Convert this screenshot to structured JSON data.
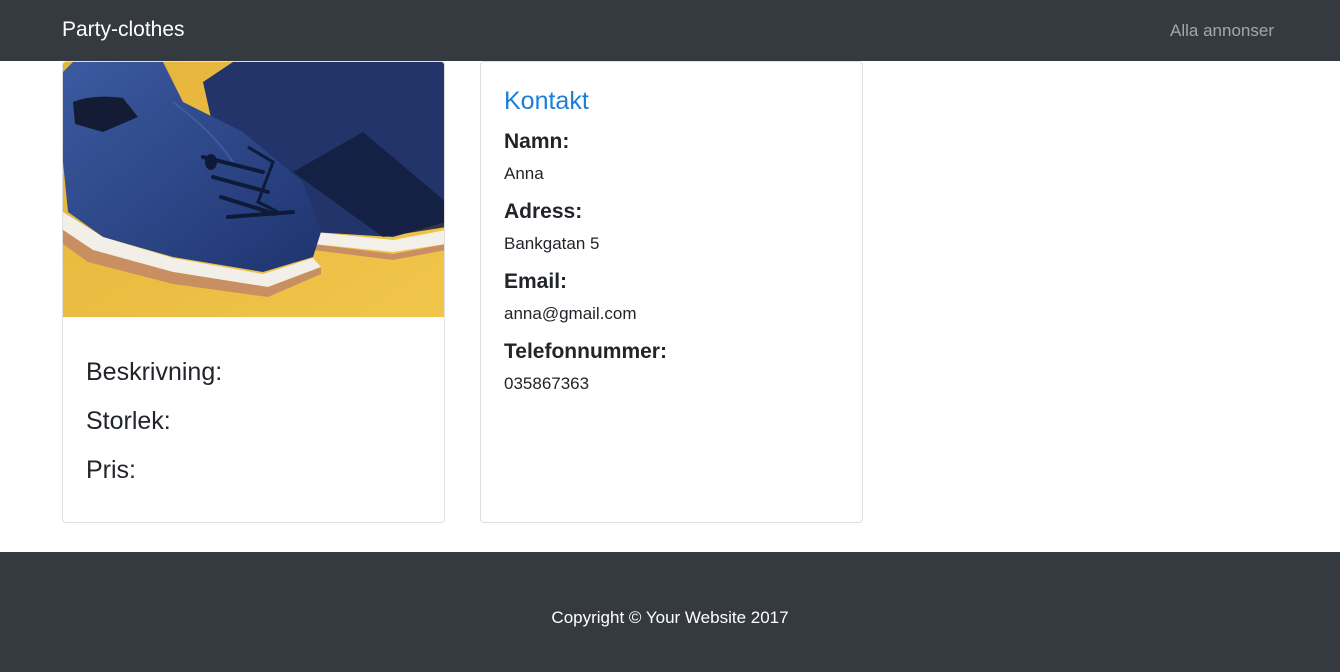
{
  "navbar": {
    "brand": "Party-clothes",
    "link": "Alla annonser"
  },
  "product": {
    "image_alt": "Blue suede shoes",
    "fields": [
      {
        "label": "Beskrivning:"
      },
      {
        "label": "Storlek:"
      },
      {
        "label": "Pris:"
      }
    ]
  },
  "contact": {
    "title": "Kontakt",
    "fields": [
      {
        "label": "Namn:",
        "value": "Anna"
      },
      {
        "label": "Adress:",
        "value": "Bankgatan 5"
      },
      {
        "label": "Email:",
        "value": "anna@gmail.com"
      },
      {
        "label": "Telefonnummer:",
        "value": "035867363"
      }
    ]
  },
  "footer": {
    "copyright": "Copyright © Your Website 2017"
  },
  "colors": {
    "navbar_bg": "#343a40",
    "accent": "#1c7ed6",
    "footer_bg": "#343a40"
  }
}
